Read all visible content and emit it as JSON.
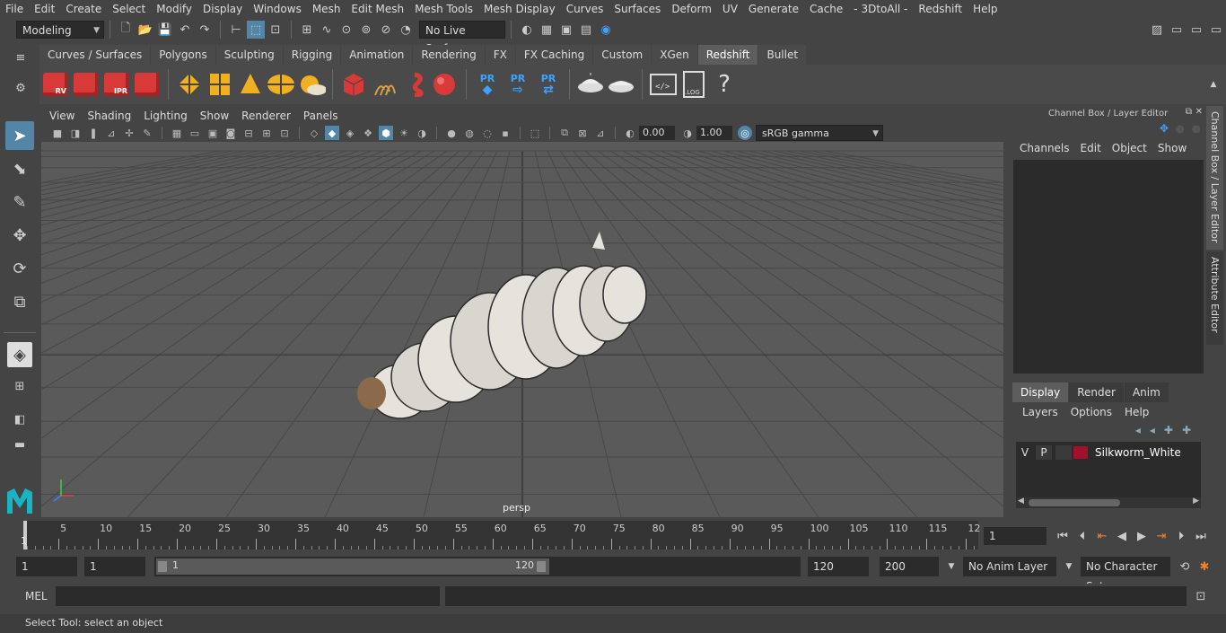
{
  "menu": [
    "File",
    "Edit",
    "Create",
    "Select",
    "Modify",
    "Display",
    "Windows",
    "Mesh",
    "Edit Mesh",
    "Mesh Tools",
    "Mesh Display",
    "Curves",
    "Surfaces",
    "Deform",
    "UV",
    "Generate",
    "Cache",
    "- 3DtoAll -",
    "Redshift",
    "Help"
  ],
  "status": {
    "mode": "Modeling",
    "live_surface": "No Live Surface"
  },
  "shelf_tabs": [
    "Curves / Surfaces",
    "Polygons",
    "Sculpting",
    "Rigging",
    "Animation",
    "Rendering",
    "FX",
    "FX Caching",
    "Custom",
    "XGen",
    "Redshift",
    "Bullet"
  ],
  "shelf_active": "Redshift",
  "shelf": {
    "rv": "RV",
    "ipr": "IPR",
    "pr": "PR",
    "log": ".LOG",
    "help": "?"
  },
  "viewport": {
    "menu": [
      "View",
      "Shading",
      "Lighting",
      "Show",
      "Renderer",
      "Panels"
    ],
    "exposure": "0.00",
    "gamma": "1.00",
    "colorspace": "sRGB gamma",
    "camera": "persp"
  },
  "channel_box": {
    "title": "Channel Box / Layer Editor",
    "menu": [
      "Channels",
      "Edit",
      "Object",
      "Show"
    ]
  },
  "layer_editor": {
    "tabs": [
      "Display",
      "Render",
      "Anim"
    ],
    "active_tab": "Display",
    "menu": [
      "Layers",
      "Options",
      "Help"
    ],
    "layers": [
      {
        "v": "V",
        "p": "P",
        "name": "Silkworm_White",
        "color": "#a3102b"
      }
    ]
  },
  "side_tabs": [
    "Channel Box / Layer Editor",
    "Attribute Editor"
  ],
  "timeline": {
    "labels": [
      "5",
      "10",
      "15",
      "20",
      "25",
      "30",
      "35",
      "40",
      "45",
      "50",
      "55",
      "60",
      "65",
      "70",
      "75",
      "80",
      "85",
      "90",
      "95",
      "100",
      "105",
      "110",
      "115",
      "12"
    ],
    "start_label": "1",
    "current_frame": "1"
  },
  "range": {
    "start": "1",
    "anim_start": "1",
    "slider_start": "1",
    "slider_end": "120",
    "anim_end": "120",
    "end": "200",
    "anim_layer": "No Anim Layer",
    "character_set": "No Character Set"
  },
  "cmd": {
    "label": "MEL"
  },
  "help_text": "Select Tool: select an object",
  "colors": {
    "accent": "#5285a6",
    "redshift": "#d83a3a",
    "layer": "#a3102b"
  }
}
